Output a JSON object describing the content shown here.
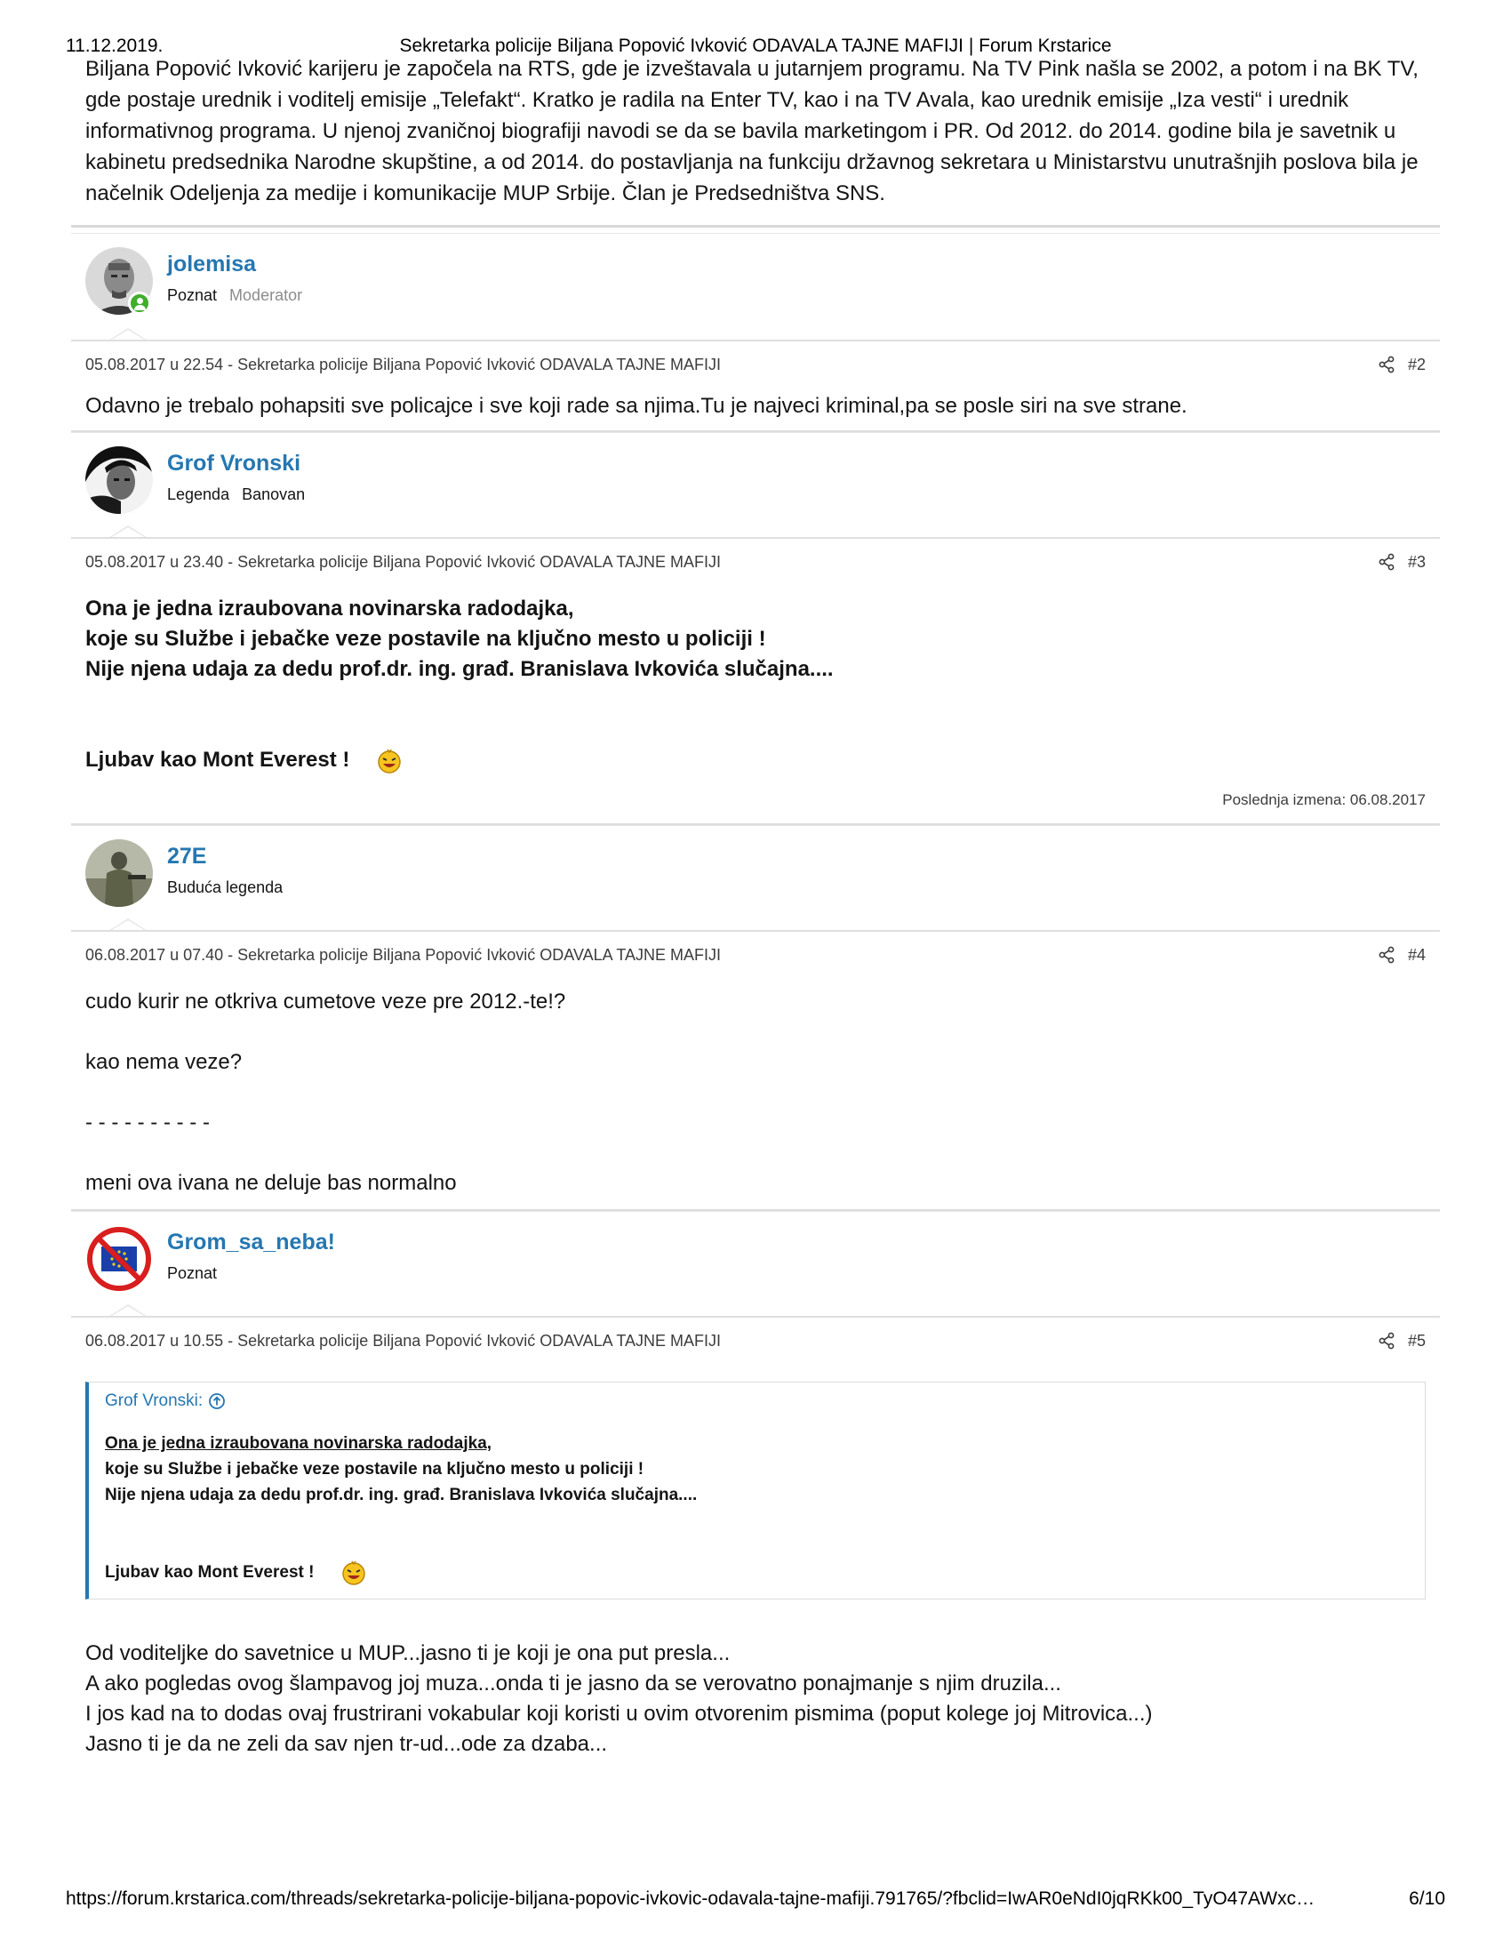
{
  "print_header": {
    "date": "11.12.2019.",
    "title": "Sekretarka policije Biljana Popović Ivković ODAVALA TAJNE MAFIJI | Forum Krstarice"
  },
  "intro_text": "Biljana Popović Ivković karijeru je započela na RTS, gde je izveštavala u jutarnjem programu. Na TV Pink našla se 2002, a potom i na BK TV, gde postaje urednik i voditelj emisije „Telefakt“. Kratko je radila na Enter TV, kao i na TV Avala, kao urednik emisije „Iza vesti“ i urednik informativnog programa. U njenoj zvaničnoj biografiji navodi se da se bavila marketingom i PR. Od 2012. do 2014. godine bila je savetnik u kabinetu predsednika Narodne skupštine, a od 2014. do postavljanja na funkciju državnog sekretara u Ministarstvu unutrašnjih poslova bila je načelnik Odeljenja za medije i komunikacije MUP Srbije. Član je Predsedništva SNS.",
  "posts": [
    {
      "user": "jolemisa",
      "title": "Poznat",
      "role": "Moderator",
      "meta": "05.08.2017 u 22.54 - Sekretarka policije Biljana Popović Ivković ODAVALA TAJNE MAFIJI",
      "number": "#2",
      "lines": [
        "Odavno je trebalo pohapsiti sve policajce i sve koji rade sa njima.Tu je najveci kriminal,pa se posle siri na sve strane."
      ]
    },
    {
      "user": "Grof Vronski",
      "title": "Legenda",
      "role": "Banovan",
      "meta": "05.08.2017 u 23.40 - Sekretarka policije Biljana Popović Ivković ODAVALA TAJNE MAFIJI",
      "number": "#3",
      "lines": [
        "Ona je jedna izraubovana novinarska radodajka,",
        "koje su Službe i jebačke veze postavile na ključno mesto u policiji !",
        "Nije njena udaja za dedu prof.dr. ing. građ. Branislava Ivkovića slučajna....",
        "Ljubav kao Mont Everest !"
      ],
      "last_edit": "Poslednja izmena: 06.08.2017"
    },
    {
      "user": "27E",
      "title": "Buduća legenda",
      "meta": "06.08.2017 u 07.40 - Sekretarka policije Biljana Popović Ivković ODAVALA TAJNE MAFIJI",
      "number": "#4",
      "lines": [
        "cudo kurir ne otkriva cumetove veze pre 2012.-te!?",
        "kao nema veze?",
        "- - - - - - - - - -",
        "meni ova ivana ne deluje bas normalno"
      ]
    },
    {
      "user": "Grom_sa_neba!",
      "title": "Poznat",
      "meta": "06.08.2017 u 10.55 - Sekretarka policije Biljana Popović Ivković ODAVALA TAJNE MAFIJI",
      "number": "#5",
      "quote": {
        "author": "Grof Vronski:",
        "lines": [
          "Ona je jedna izraubovana novinarska radodajka,",
          "koje su Službe i jebačke veze postavile na ključno mesto u policiji !",
          "Nije njena udaja za dedu prof.dr. ing. građ. Branislava Ivkovića slučajna....",
          "Ljubav kao Mont Everest !"
        ]
      },
      "lines": [
        "Od voditeljke do savetnice u MUP...jasno ti je koji je ona put presla...",
        "A ako pogledas ovog šlampavog joj muza...onda ti je jasno da se verovatno ponajmanje s njim druzila...",
        "I jos kad na to dodas ovaj frustrirani vokabular koji koristi u ovim otvorenim pismima (poput kolege joj Mitrovica...)",
        "Jasno ti je da ne zeli da sav njen tr-ud...ode za dzaba..."
      ]
    }
  ],
  "print_footer": {
    "url": "https://forum.krstarica.com/threads/sekretarka-policije-biljana-popovic-ivkovic-odavala-tajne-mafiji.791765/?fbclid=IwAR0eNdI0jqRKk00_TyO47AWxc…",
    "page": "6/10"
  },
  "colors": {
    "link": "#2577b1",
    "online": "#3fae2a",
    "separator": "#dcdcdc"
  },
  "icons": [
    "share-icon",
    "arrow-up-circle-icon",
    "laughing-smiley-icon",
    "online-status-icon"
  ]
}
